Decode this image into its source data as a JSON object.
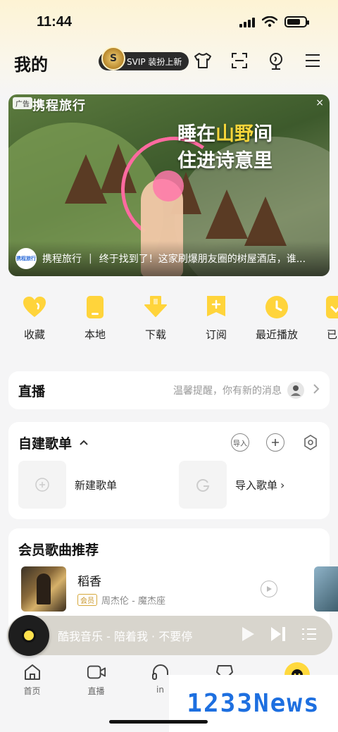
{
  "status_bar": {
    "time": "11:44"
  },
  "header": {
    "title": "我的",
    "svip_crest": "S",
    "svip_label": "SVIP 装扮上新",
    "icons": [
      "tshirt-icon",
      "scan-icon",
      "voice-icon",
      "menu-icon"
    ]
  },
  "ad": {
    "tag": "广告",
    "brand": "携程旅行",
    "close": "×",
    "headline_line1_a": "睡在",
    "headline_line1_b": "山野",
    "headline_line1_c": "间",
    "headline_line2": "住进诗意里",
    "footer_logo": "携程旅行",
    "footer_brand": "携程旅行",
    "footer_sep": "|",
    "footer_desc": "终于找到了！这家刷爆朋友圈的树屋酒店，谁..."
  },
  "quick_actions": [
    {
      "label": "收藏",
      "icon": "heart-icon"
    },
    {
      "label": "本地",
      "icon": "phone-icon"
    },
    {
      "label": "下载",
      "icon": "download-icon"
    },
    {
      "label": "订阅",
      "icon": "subscribe-icon"
    },
    {
      "label": "最近播放",
      "icon": "clock-icon"
    },
    {
      "label": "已购",
      "icon": "check-icon"
    }
  ],
  "live": {
    "title": "直播",
    "hint": "温馨提醒，你有新的消息"
  },
  "playlists": {
    "title": "自建歌单",
    "import_btn": "导入",
    "new_label": "新建歌单",
    "import_label": "导入歌单",
    "import_chevron": "›"
  },
  "vip_songs": {
    "title": "会员歌曲推荐",
    "song_title": "稻香",
    "vip_tag": "会员",
    "song_meta": "周杰伦 - 魔杰座"
  },
  "player": {
    "text": "酷我音乐 - 陪着我 · 不要停"
  },
  "tabs": [
    {
      "label": "首页",
      "icon": "home-icon"
    },
    {
      "label": "直播",
      "icon": "video-icon"
    },
    {
      "label": "in",
      "icon": "headphones-icon"
    },
    {
      "label": "",
      "icon": "message-icon"
    },
    {
      "label": "",
      "icon": "me-icon"
    }
  ],
  "watermark": "1233News",
  "colors": {
    "accent": "#ffd93d",
    "brand_blue": "#1d6fe0"
  }
}
